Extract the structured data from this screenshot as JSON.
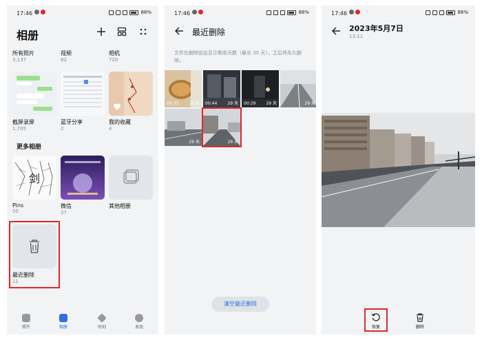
{
  "status": {
    "time": "17:46",
    "battery": "88%"
  },
  "screen1": {
    "title": "相册",
    "albums_top": [
      {
        "name": "所有照片",
        "count": "3,137"
      },
      {
        "name": "视频",
        "count": "82"
      },
      {
        "name": "相机",
        "count": "720"
      }
    ],
    "albums_row2": [
      {
        "name": "截屏录屏",
        "count": "1,705"
      },
      {
        "name": "蓝牙分享",
        "count": "2"
      },
      {
        "name": "我的收藏",
        "count": "4"
      }
    ],
    "more_title": "更多相册",
    "albums_row3": [
      {
        "name": "Pins",
        "count": "50",
        "thumb_text": "剑"
      },
      {
        "name": "微信",
        "count": "37"
      },
      {
        "name": "其他相册",
        "count": ""
      }
    ],
    "recently_deleted": {
      "name": "最近删除",
      "count": "11"
    },
    "tabs": [
      {
        "label": "照片"
      },
      {
        "label": "相册"
      },
      {
        "label": "时刻"
      },
      {
        "label": "发现"
      }
    ]
  },
  "screen2": {
    "title": "最近删除",
    "hint": "文件在删除前会显示剩余天数（最长 30 天），之后将永久删除。",
    "items": [
      {
        "duration": "00:33",
        "days": "29 天"
      },
      {
        "duration": "00:44",
        "days": "29 天"
      },
      {
        "duration": "00:29",
        "days": "29 天"
      },
      {
        "duration": "",
        "days": "29 天"
      },
      {
        "duration": "",
        "days": "29 天"
      },
      {
        "duration": "",
        "days": "29 天"
      }
    ],
    "clear_button": "清空最近删除"
  },
  "screen3": {
    "date": "2023年5月7日",
    "time": "13:11",
    "restore_label": "恢复",
    "delete_label": "删除"
  },
  "colors": {
    "accent": "#2e6ee6",
    "highlight": "#e0262c"
  }
}
